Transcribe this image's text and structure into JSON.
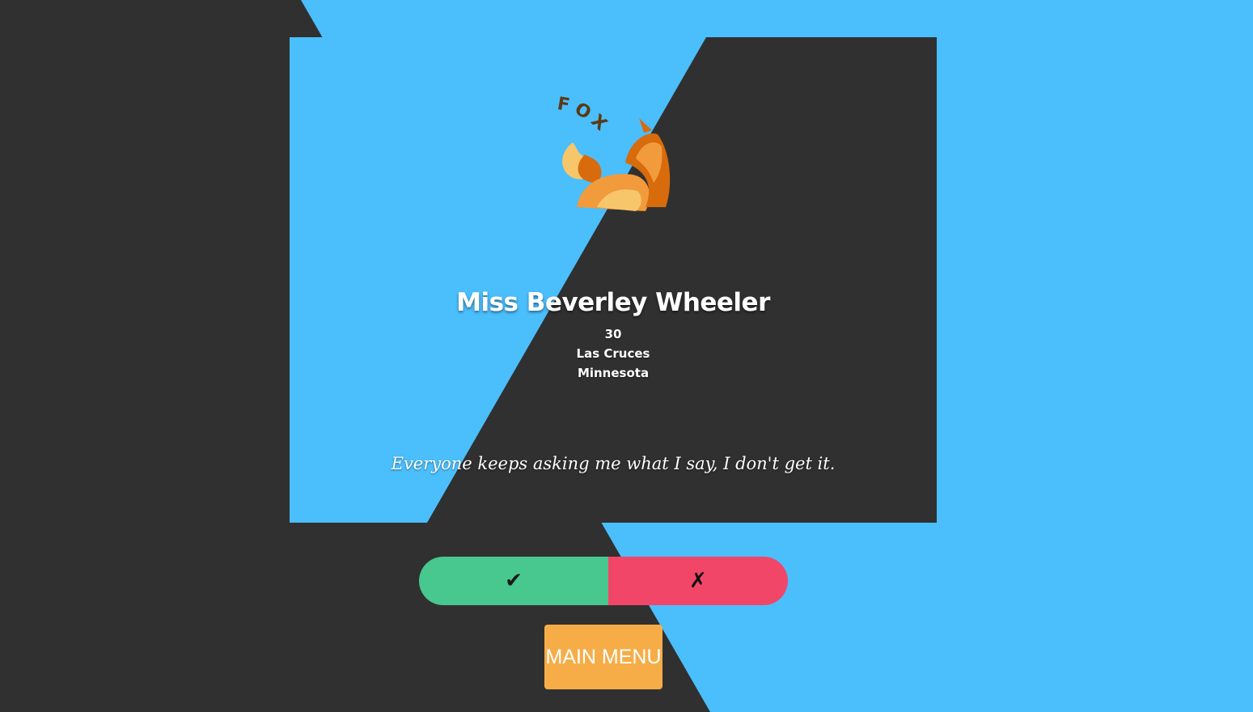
{
  "colors": {
    "dark": "#303030",
    "sky": "#4bbefc",
    "accept": "#48c78e",
    "reject": "#f14668",
    "menu": "#f6ad48"
  },
  "logo": {
    "text": "FOXY",
    "icon": "fox-logo-icon"
  },
  "profile": {
    "name": "Miss Beverley Wheeler",
    "age": "30",
    "city": "Las Cruces",
    "state": "Minnesota",
    "bio": "Everyone keeps asking me what I say, I don't get it."
  },
  "actions": {
    "accept_symbol": "✔",
    "reject_symbol": "✗",
    "menu_label": "MAIN MENU"
  }
}
